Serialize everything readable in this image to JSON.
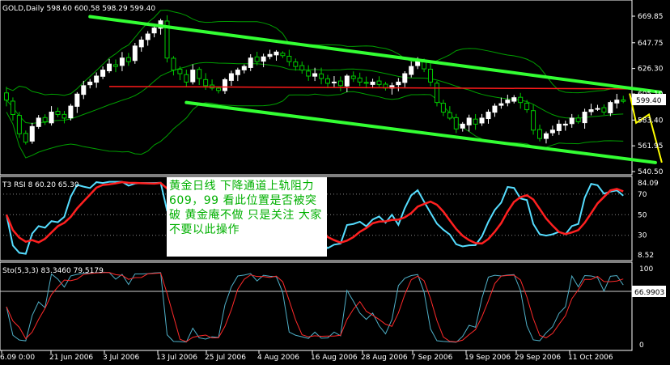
{
  "main_header": "GOLD,Daily  598.60 600.58 598.29 599.40",
  "rsi_header": "T3 RSI 8 60.20 65.30",
  "sto_header": "Sto(5,3,3) 83.3460 79.5179",
  "annotation": "黄金日线  下降通道上轨阻力609，99  看此位置是否被突破  黄金庵不做  只是关注  大家不要以此操作",
  "price_labels": [
    "669.85",
    "647.75",
    "626.30",
    "605.10",
    "583.40",
    "561.95",
    "540.50"
  ],
  "current_price_label": "599.40",
  "rsi_labels": [
    "84.09",
    "70",
    "50",
    "30",
    "8.52"
  ],
  "sto_labels": [
    "100",
    "66.9903",
    "0"
  ],
  "date_labels": [
    "6.09 0:00",
    "21 Jun 2006",
    "3 Jul 2006",
    "13 Jul 2006",
    "25 Jul 2006",
    "4 Aug 2006",
    "16 Aug 2006",
    "28 Aug 2006",
    "7 Sep 2006",
    "19 Sep 2006",
    "29 Sep 2006",
    "11 Oct 2006"
  ],
  "colors": {
    "background": "#000000",
    "bull": "#ffffff",
    "bear": "#00cc00",
    "channel": "#33ff33",
    "resistance": "#ff1a1a",
    "projection": "#ffff00",
    "bands": "#00a000",
    "rsi_fast": "#55ddff",
    "rsi_slow": "#ff2020",
    "sto_main": "#4fb0c8",
    "sto_signal": "#ff2a2a",
    "text": "#ffffff"
  },
  "chart_data": [
    {
      "type": "candlestick",
      "symbol": "GOLD",
      "timeframe": "Daily",
      "ylim": [
        540.5,
        669.85
      ],
      "x_start": "2006-06-09",
      "close": [
        600,
        588,
        572,
        565,
        578,
        585,
        582,
        590,
        588,
        585,
        595,
        605,
        612,
        615,
        620,
        625,
        630,
        628,
        635,
        632,
        645,
        650,
        655,
        660,
        666,
        635,
        625,
        622,
        615,
        625,
        618,
        612,
        610,
        608,
        617,
        622,
        625,
        628,
        635,
        632,
        636,
        638,
        640,
        637,
        632,
        628,
        625,
        620,
        622,
        618,
        614,
        615,
        612,
        620,
        618,
        615,
        614,
        615,
        613,
        610,
        612,
        615,
        622,
        628,
        632,
        626,
        615,
        598,
        590,
        585,
        576,
        580,
        585,
        580,
        585,
        590,
        595,
        597,
        600,
        602,
        598,
        592,
        575,
        568,
        572,
        575,
        580,
        580,
        585,
        582,
        590,
        592,
        593,
        590,
        598,
        600,
        599
      ],
      "resistance_level": 609.99,
      "channel_upper": [
        [
          13,
          669.5
        ],
        [
          97,
          609.99
        ]
      ],
      "channel_lower": [
        [
          28,
          598.0
        ],
        [
          101,
          548.0
        ]
      ],
      "projection": [
        [
          97,
          605.5
        ],
        [
          98,
          581
        ],
        [
          100,
          588
        ],
        [
          102,
          548
        ]
      ]
    },
    {
      "type": "line",
      "name": "T3 RSI",
      "ylim": [
        8.52,
        84.09
      ],
      "levels": [
        30,
        50,
        70
      ]
    },
    {
      "type": "line",
      "name": "Sto(5,3,3)",
      "ylim": [
        0,
        100
      ],
      "level": 66.9903
    }
  ]
}
